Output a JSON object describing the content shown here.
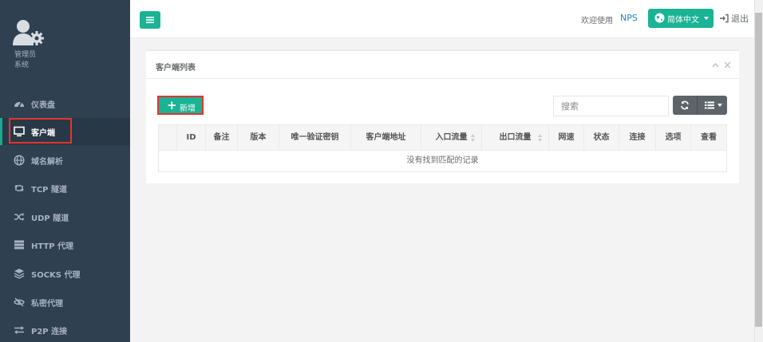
{
  "sidebar": {
    "profile": {
      "name": "管理员",
      "role": "系统"
    },
    "items": [
      {
        "id": "dashboard",
        "label": "仪表盘",
        "icon": "dashboard-icon"
      },
      {
        "id": "client",
        "label": "客户端",
        "icon": "monitor-icon",
        "active": true
      },
      {
        "id": "domain",
        "label": "域名解析",
        "icon": "globe-icon"
      },
      {
        "id": "tcp",
        "label": "TCP 隧道",
        "icon": "retweet-icon"
      },
      {
        "id": "udp",
        "label": "UDP 隧道",
        "icon": "random-icon"
      },
      {
        "id": "http",
        "label": "HTTP 代理",
        "icon": "server-icon"
      },
      {
        "id": "socks",
        "label": "SOCKS 代理",
        "icon": "stack-icon"
      },
      {
        "id": "secret",
        "label": "私密代理",
        "icon": "eye-slash-icon"
      },
      {
        "id": "p2p",
        "label": "P2P 连接",
        "icon": "exchange-icon"
      }
    ]
  },
  "topbar": {
    "welcome": "欢迎使用",
    "brand": "NPS",
    "language": "简体中文",
    "logout": "退出"
  },
  "panel": {
    "title": "客户端列表",
    "add_label": "新增",
    "search_placeholder": "搜索",
    "columns": [
      "ID",
      "备注",
      "版本",
      "唯一验证密钥",
      "客户端地址",
      "入口流量",
      "出口流量",
      "网速",
      "状态",
      "连接",
      "选项",
      "查看"
    ],
    "empty_message": "没有找到匹配的记录"
  },
  "colors": {
    "sidebar_bg": "#2f4050",
    "accent": "#1ab394",
    "link": "#1c84c6",
    "highlight_outline": "#e3342f"
  }
}
